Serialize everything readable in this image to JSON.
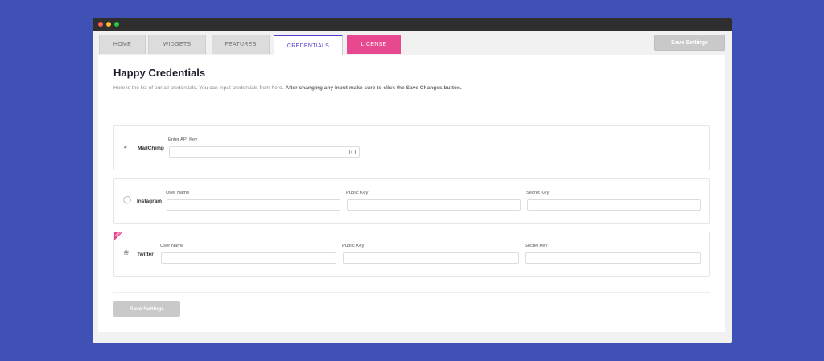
{
  "tabs": [
    {
      "label": "HOME"
    },
    {
      "label": "WIDGETS"
    },
    {
      "label": "FEATURES"
    },
    {
      "label": "CREDENTIALS",
      "active": true
    },
    {
      "label": "LICENSE"
    }
  ],
  "toolbar": {
    "save_label": "Save Settings"
  },
  "page": {
    "title": "Happy Credentials",
    "description": "Here is the list of our all credentials. You can input credentials from here.",
    "description_bold": "After changing any input make sure to click the Save Changes button."
  },
  "mailchimp": {
    "name": "MailChimp",
    "api_key_label": "Enter API Key",
    "api_key_value": ""
  },
  "instagram": {
    "name": "Instagram",
    "user_name_label": "User Name",
    "public_key_label": "Public Key",
    "secret_key_label": "Secret Key",
    "user_name_value": "",
    "public_key_value": "",
    "secret_key_value": ""
  },
  "twitter": {
    "name": "Twitter",
    "badge": "PRO",
    "user_name_label": "User Name",
    "public_key_label": "Public Key",
    "secret_key_label": "Secret Key",
    "user_name_value": "",
    "public_key_value": "",
    "secret_key_value": ""
  },
  "footer": {
    "save_label": "Save Settings"
  },
  "colors": {
    "background": "#3f51b5",
    "accent": "#4c3ad1",
    "license": "#e8488f"
  }
}
